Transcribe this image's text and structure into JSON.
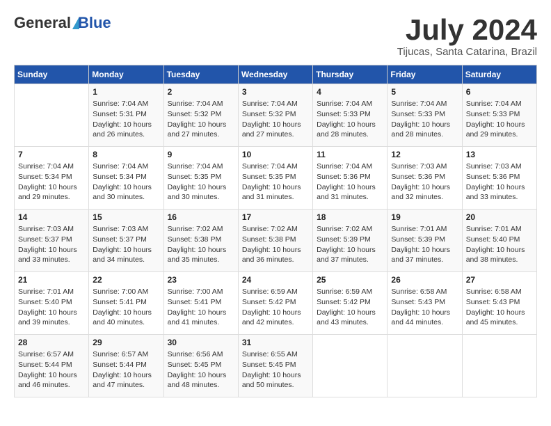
{
  "logo": {
    "general": "General",
    "blue": "Blue"
  },
  "title": "July 2024",
  "location": "Tijucas, Santa Catarina, Brazil",
  "days_of_week": [
    "Sunday",
    "Monday",
    "Tuesday",
    "Wednesday",
    "Thursday",
    "Friday",
    "Saturday"
  ],
  "weeks": [
    [
      {
        "day": "",
        "info": ""
      },
      {
        "day": "1",
        "info": "Sunrise: 7:04 AM\nSunset: 5:31 PM\nDaylight: 10 hours\nand 26 minutes."
      },
      {
        "day": "2",
        "info": "Sunrise: 7:04 AM\nSunset: 5:32 PM\nDaylight: 10 hours\nand 27 minutes."
      },
      {
        "day": "3",
        "info": "Sunrise: 7:04 AM\nSunset: 5:32 PM\nDaylight: 10 hours\nand 27 minutes."
      },
      {
        "day": "4",
        "info": "Sunrise: 7:04 AM\nSunset: 5:33 PM\nDaylight: 10 hours\nand 28 minutes."
      },
      {
        "day": "5",
        "info": "Sunrise: 7:04 AM\nSunset: 5:33 PM\nDaylight: 10 hours\nand 28 minutes."
      },
      {
        "day": "6",
        "info": "Sunrise: 7:04 AM\nSunset: 5:33 PM\nDaylight: 10 hours\nand 29 minutes."
      }
    ],
    [
      {
        "day": "7",
        "info": "Sunrise: 7:04 AM\nSunset: 5:34 PM\nDaylight: 10 hours\nand 29 minutes."
      },
      {
        "day": "8",
        "info": "Sunrise: 7:04 AM\nSunset: 5:34 PM\nDaylight: 10 hours\nand 30 minutes."
      },
      {
        "day": "9",
        "info": "Sunrise: 7:04 AM\nSunset: 5:35 PM\nDaylight: 10 hours\nand 30 minutes."
      },
      {
        "day": "10",
        "info": "Sunrise: 7:04 AM\nSunset: 5:35 PM\nDaylight: 10 hours\nand 31 minutes."
      },
      {
        "day": "11",
        "info": "Sunrise: 7:04 AM\nSunset: 5:36 PM\nDaylight: 10 hours\nand 31 minutes."
      },
      {
        "day": "12",
        "info": "Sunrise: 7:03 AM\nSunset: 5:36 PM\nDaylight: 10 hours\nand 32 minutes."
      },
      {
        "day": "13",
        "info": "Sunrise: 7:03 AM\nSunset: 5:36 PM\nDaylight: 10 hours\nand 33 minutes."
      }
    ],
    [
      {
        "day": "14",
        "info": "Sunrise: 7:03 AM\nSunset: 5:37 PM\nDaylight: 10 hours\nand 33 minutes."
      },
      {
        "day": "15",
        "info": "Sunrise: 7:03 AM\nSunset: 5:37 PM\nDaylight: 10 hours\nand 34 minutes."
      },
      {
        "day": "16",
        "info": "Sunrise: 7:02 AM\nSunset: 5:38 PM\nDaylight: 10 hours\nand 35 minutes."
      },
      {
        "day": "17",
        "info": "Sunrise: 7:02 AM\nSunset: 5:38 PM\nDaylight: 10 hours\nand 36 minutes."
      },
      {
        "day": "18",
        "info": "Sunrise: 7:02 AM\nSunset: 5:39 PM\nDaylight: 10 hours\nand 37 minutes."
      },
      {
        "day": "19",
        "info": "Sunrise: 7:01 AM\nSunset: 5:39 PM\nDaylight: 10 hours\nand 37 minutes."
      },
      {
        "day": "20",
        "info": "Sunrise: 7:01 AM\nSunset: 5:40 PM\nDaylight: 10 hours\nand 38 minutes."
      }
    ],
    [
      {
        "day": "21",
        "info": "Sunrise: 7:01 AM\nSunset: 5:40 PM\nDaylight: 10 hours\nand 39 minutes."
      },
      {
        "day": "22",
        "info": "Sunrise: 7:00 AM\nSunset: 5:41 PM\nDaylight: 10 hours\nand 40 minutes."
      },
      {
        "day": "23",
        "info": "Sunrise: 7:00 AM\nSunset: 5:41 PM\nDaylight: 10 hours\nand 41 minutes."
      },
      {
        "day": "24",
        "info": "Sunrise: 6:59 AM\nSunset: 5:42 PM\nDaylight: 10 hours\nand 42 minutes."
      },
      {
        "day": "25",
        "info": "Sunrise: 6:59 AM\nSunset: 5:42 PM\nDaylight: 10 hours\nand 43 minutes."
      },
      {
        "day": "26",
        "info": "Sunrise: 6:58 AM\nSunset: 5:43 PM\nDaylight: 10 hours\nand 44 minutes."
      },
      {
        "day": "27",
        "info": "Sunrise: 6:58 AM\nSunset: 5:43 PM\nDaylight: 10 hours\nand 45 minutes."
      }
    ],
    [
      {
        "day": "28",
        "info": "Sunrise: 6:57 AM\nSunset: 5:44 PM\nDaylight: 10 hours\nand 46 minutes."
      },
      {
        "day": "29",
        "info": "Sunrise: 6:57 AM\nSunset: 5:44 PM\nDaylight: 10 hours\nand 47 minutes."
      },
      {
        "day": "30",
        "info": "Sunrise: 6:56 AM\nSunset: 5:45 PM\nDaylight: 10 hours\nand 48 minutes."
      },
      {
        "day": "31",
        "info": "Sunrise: 6:55 AM\nSunset: 5:45 PM\nDaylight: 10 hours\nand 50 minutes."
      },
      {
        "day": "",
        "info": ""
      },
      {
        "day": "",
        "info": ""
      },
      {
        "day": "",
        "info": ""
      }
    ]
  ]
}
